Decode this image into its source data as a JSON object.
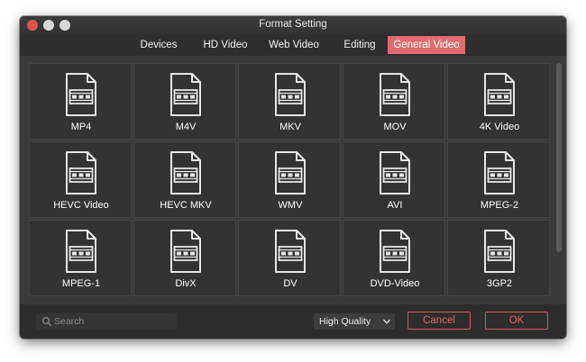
{
  "window": {
    "title": "Format Setting"
  },
  "tabs": [
    {
      "label": "Devices",
      "active": false
    },
    {
      "label": "HD Video",
      "active": false
    },
    {
      "label": "Web Video",
      "active": false
    },
    {
      "label": "Editing",
      "active": false
    },
    {
      "label": "General Video",
      "active": true
    }
  ],
  "formats": [
    {
      "label": "MP4",
      "icon": "video-file-icon"
    },
    {
      "label": "M4V",
      "icon": "video-file-icon"
    },
    {
      "label": "MKV",
      "icon": "video-file-icon"
    },
    {
      "label": "MOV",
      "icon": "video-file-icon"
    },
    {
      "label": "4K Video",
      "icon": "video-file-icon"
    },
    {
      "label": "HEVC Video",
      "icon": "video-file-icon"
    },
    {
      "label": "HEVC MKV",
      "icon": "video-file-icon"
    },
    {
      "label": "WMV",
      "icon": "video-file-icon"
    },
    {
      "label": "AVI",
      "icon": "video-file-icon"
    },
    {
      "label": "MPEG-2",
      "icon": "video-file-icon"
    },
    {
      "label": "MPEG-1",
      "icon": "video-file-icon"
    },
    {
      "label": "DivX",
      "icon": "video-file-icon"
    },
    {
      "label": "DV",
      "icon": "video-file-icon"
    },
    {
      "label": "DVD-Video",
      "icon": "video-file-icon"
    },
    {
      "label": "3GP2",
      "icon": "video-file-icon"
    }
  ],
  "footer": {
    "search_placeholder": "Search",
    "search_value": "",
    "quality_value": "High Quality",
    "cancel_label": "Cancel",
    "ok_label": "OK"
  },
  "colors": {
    "accent": "#df6b70",
    "window_bg": "#3a3a3a",
    "cell_bg": "#333333",
    "close_button": "#e0554a"
  }
}
